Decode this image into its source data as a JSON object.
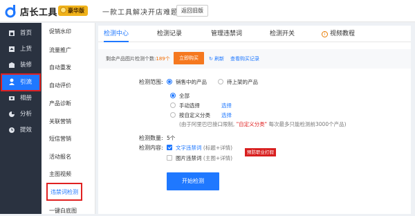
{
  "header": {
    "brand": "店长工具",
    "badge": "豪华版",
    "slogan": "一款工具解决开店难题",
    "back_label": "返回旧版",
    "accent": "#1f78ff"
  },
  "nav": {
    "items": [
      {
        "label": "首页",
        "icon": "home-icon"
      },
      {
        "label": "上货",
        "icon": "upload-icon"
      },
      {
        "label": "装修",
        "icon": "decorate-icon"
      },
      {
        "label": "引流",
        "icon": "user-icon",
        "active": true
      },
      {
        "label": "相册",
        "icon": "album-icon"
      },
      {
        "label": "分析",
        "icon": "chart-icon"
      },
      {
        "label": "提效",
        "icon": "clock-icon"
      }
    ]
  },
  "subnav": {
    "items": [
      "促销水印",
      "流量推广",
      "自动重发",
      "自动评价",
      "产品诊断",
      "关联营销",
      "短信营销",
      "活动报名",
      "主图视频",
      "违禁词检测",
      "一键白底图"
    ],
    "active": "违禁词检测"
  },
  "tabs": [
    "检测中心",
    "检测记录",
    "管理违禁词",
    "检测开关",
    "视频教程"
  ],
  "quota": {
    "prefix": "剩余产品图片检测个数:",
    "count": "189个",
    "buy_label": "立即购买",
    "refresh_label": "刷新",
    "records_label": "查看购买记录"
  },
  "form": {
    "range_label": "检测范围:",
    "range_options": [
      "销售中的产品",
      "待上架的产品"
    ],
    "scope_options": [
      "全部",
      "手动选择",
      "按自定义分类"
    ],
    "select_label": "选择",
    "note_prefix": "(由于阿里巴巴接口限制,",
    "note_highlight": "\"自定义分类\"",
    "note_suffix": "每次最多只能检测前3000个产品)",
    "count_label": "检测数量:",
    "count_value": "5个",
    "content_label": "检测内容:",
    "content_options": [
      {
        "name": "文字违禁词",
        "detail": "(标题+详情)",
        "checked": true
      },
      {
        "name": "图片违禁词",
        "detail": "(主图+详情)",
        "checked": false
      }
    ],
    "tag": "预防职业打假",
    "start_label": "开始检测"
  }
}
